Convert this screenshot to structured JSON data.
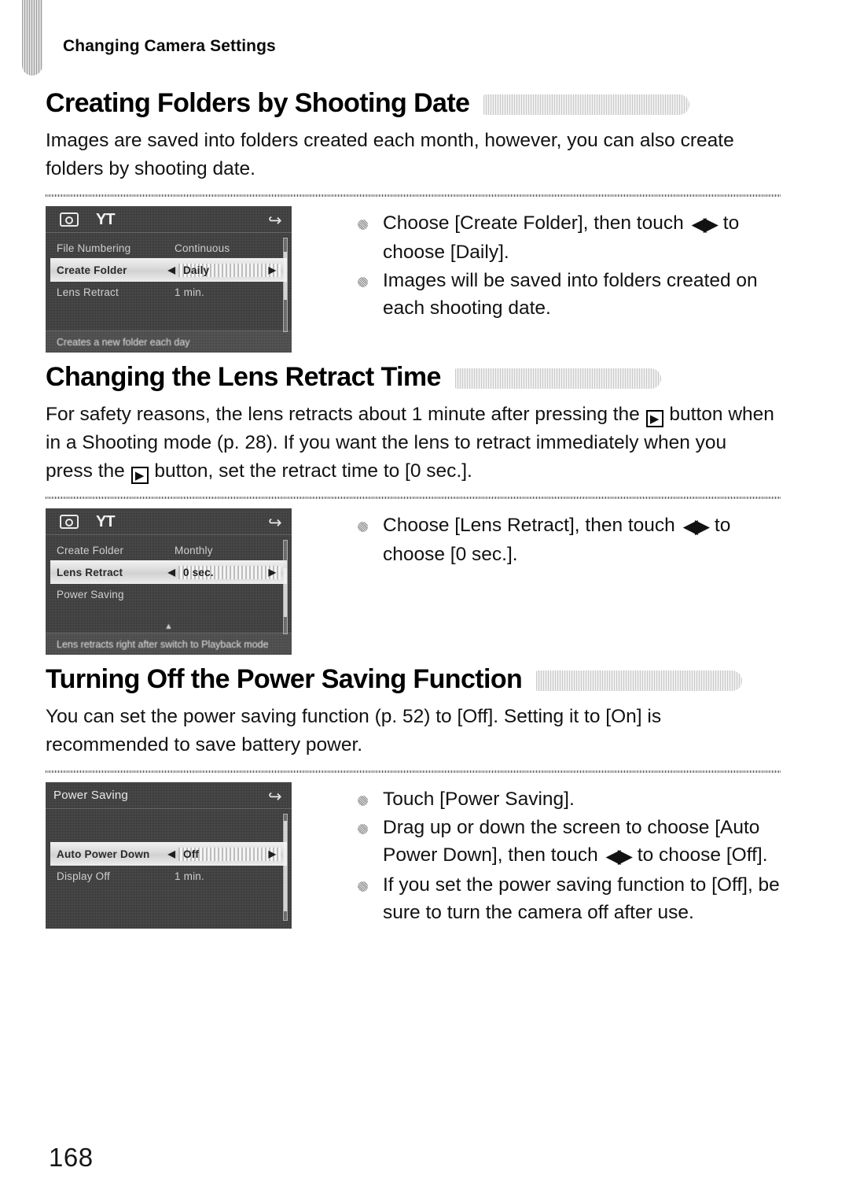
{
  "running_header": "Changing Camera Settings",
  "page_number": "168",
  "icons": {
    "camera": "camera-icon",
    "settings_tab": "wrench-tools-icon",
    "return": "return-arrow-icon",
    "playback_button": "playback-button-icon",
    "left_right_arrows": "left-right-arrows-icon",
    "bullet": "bullet-dot-icon"
  },
  "glyphs": {
    "arrows": "◀▶",
    "arrow_left": "◀",
    "arrow_right": "▶",
    "return": "↩",
    "wrench": "YT",
    "up_down": "▲"
  },
  "sections": [
    {
      "heading": "Creating Folders by Shooting Date",
      "body": [
        "Images are saved into folders created each month, however, you can also create folders by shooting date."
      ],
      "screen": {
        "type": "menu",
        "topbar": true,
        "title": "",
        "rows": [
          {
            "label": "File Numbering",
            "value": "Continuous",
            "selected": false
          },
          {
            "label": "Create Folder",
            "value": "Daily",
            "selected": true
          },
          {
            "label": "Lens Retract",
            "value": "1 min.",
            "selected": false
          }
        ],
        "caption": "Creates a new folder each day",
        "scrollbar": {
          "top_pct": 14,
          "height_pct": 52
        }
      },
      "bullets": [
        {
          "pre": "Choose [Create Folder], then touch ",
          "arrows": true,
          "post": " to choose [Daily]."
        },
        {
          "pre": "Images will be saved into folders created on each shooting date.",
          "arrows": false,
          "post": ""
        }
      ]
    },
    {
      "heading": "Changing the Lens Retract Time",
      "body_parts": [
        "For safety reasons, the lens retracts about 1 minute after pressing the ",
        " button when in a Shooting mode (p. 28). If you want the lens to retract immediately when you press the ",
        " button, set the retract time to [0 sec.]."
      ],
      "screen": {
        "type": "menu",
        "topbar": true,
        "title": "",
        "rows": [
          {
            "label": "Create Folder",
            "value": "Monthly",
            "selected": false
          },
          {
            "label": "Lens Retract",
            "value": "0 sec.",
            "selected": true
          },
          {
            "label": "Power Saving",
            "value": "",
            "selected": false
          }
        ],
        "caption": "Lens retracts right after switch to Playback mode",
        "scrollbar": {
          "top_pct": 30,
          "height_pct": 52
        }
      },
      "bullets": [
        {
          "pre": "Choose [Lens Retract], then touch ",
          "arrows": true,
          "post": " to choose [0 sec.]."
        }
      ]
    },
    {
      "heading": "Turning Off the Power Saving Function",
      "body": [
        "You can set the power saving function (p. 52) to [Off]. Setting it to [On] is recommended to save battery power."
      ],
      "screen": {
        "type": "submenu",
        "topbar": false,
        "title": "Power Saving",
        "rows": [
          {
            "label": "Auto Power Down",
            "value": "Off",
            "selected": true
          },
          {
            "label": "Display Off",
            "value": "1 min.",
            "selected": false
          }
        ],
        "caption": "",
        "scrollbar": {
          "top_pct": 6,
          "height_pct": 86
        }
      },
      "bullets": [
        {
          "pre": "Touch [Power Saving].",
          "arrows": false,
          "post": ""
        },
        {
          "pre": "Drag up or down the screen to choose [Auto Power Down], then touch ",
          "arrows": true,
          "post": " to choose [Off]."
        },
        {
          "pre": "If you set the power saving function to [Off], be sure to turn the camera off after use.",
          "arrows": false,
          "post": ""
        }
      ]
    }
  ]
}
